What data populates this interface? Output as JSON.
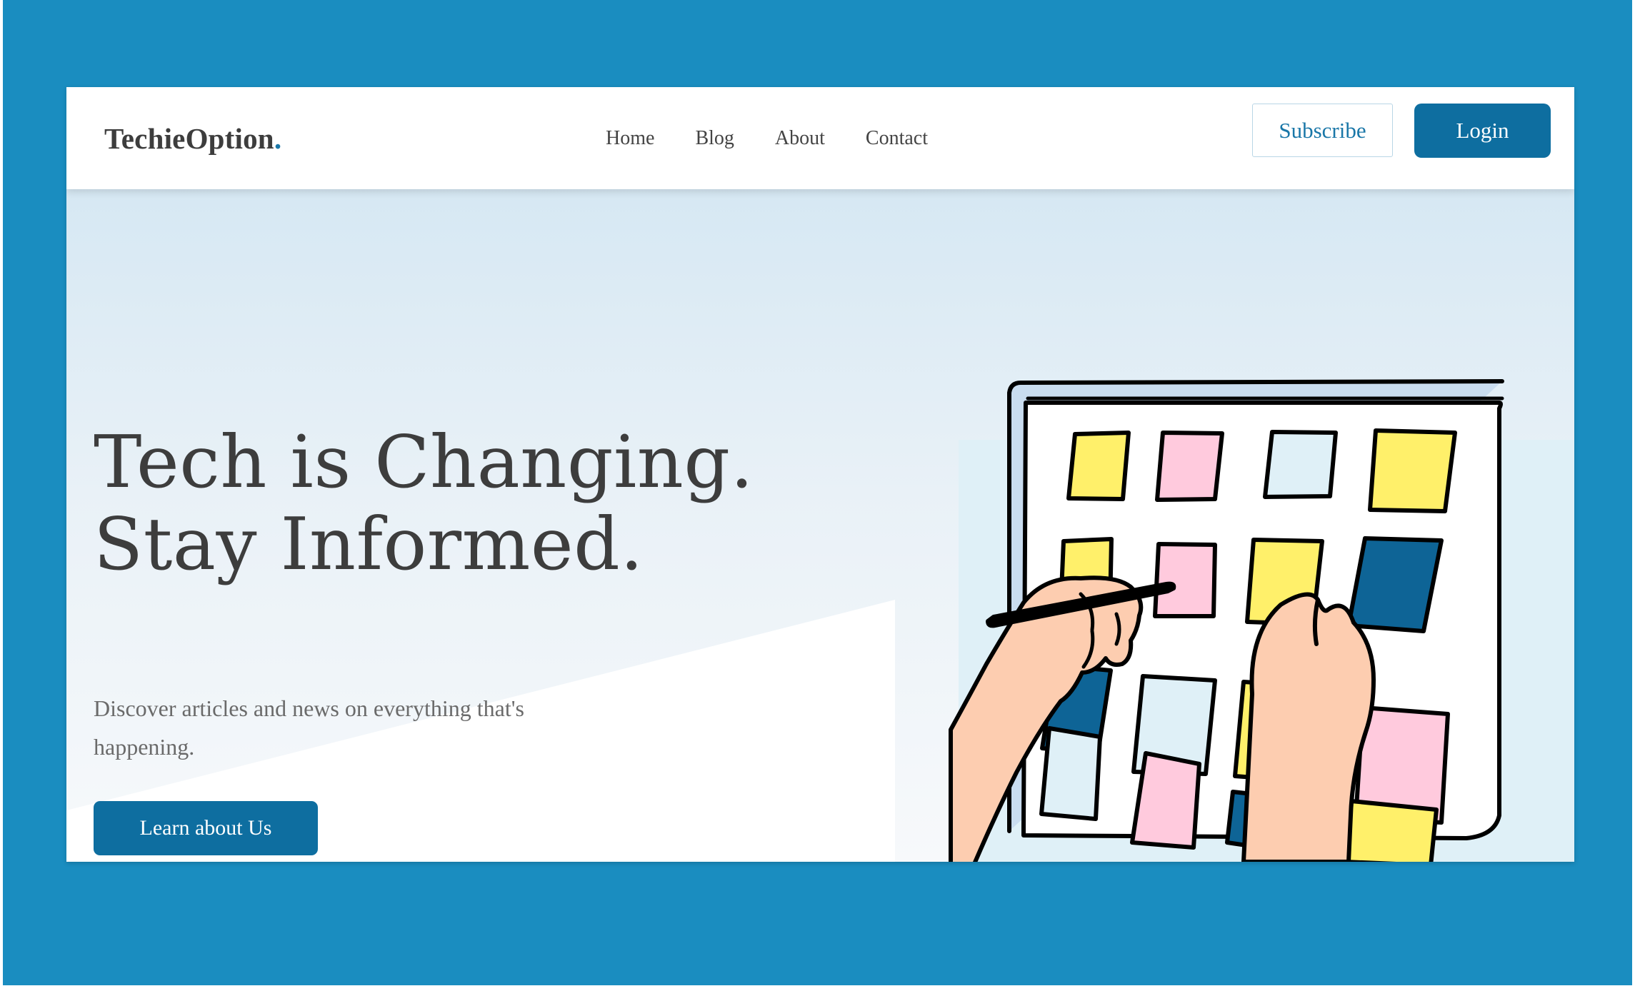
{
  "brand": {
    "name": "TechieOption",
    "dot": "."
  },
  "nav": {
    "links": [
      "Home",
      "Blog",
      "About",
      "Contact"
    ]
  },
  "actions": {
    "subscribe_label": "Subscribe",
    "login_label": "Login"
  },
  "hero": {
    "title_line1": "Tech is Changing.",
    "title_line2": "Stay Informed.",
    "subtitle": "Discover articles and news on everything that's happening.",
    "cta_label": "Learn about Us"
  },
  "colors": {
    "page_background": "#1a8dc0",
    "primary": "#0e6ea0",
    "text_dark": "#3d3d3d",
    "note_yellow": "#fff06a",
    "note_pink": "#ffcadd",
    "note_lightblue": "#dff0f7",
    "note_darkblue": "#0e6496",
    "skin": "#fdcdb0"
  },
  "illustration": {
    "icon": "sticky-notes-board-illustration"
  }
}
